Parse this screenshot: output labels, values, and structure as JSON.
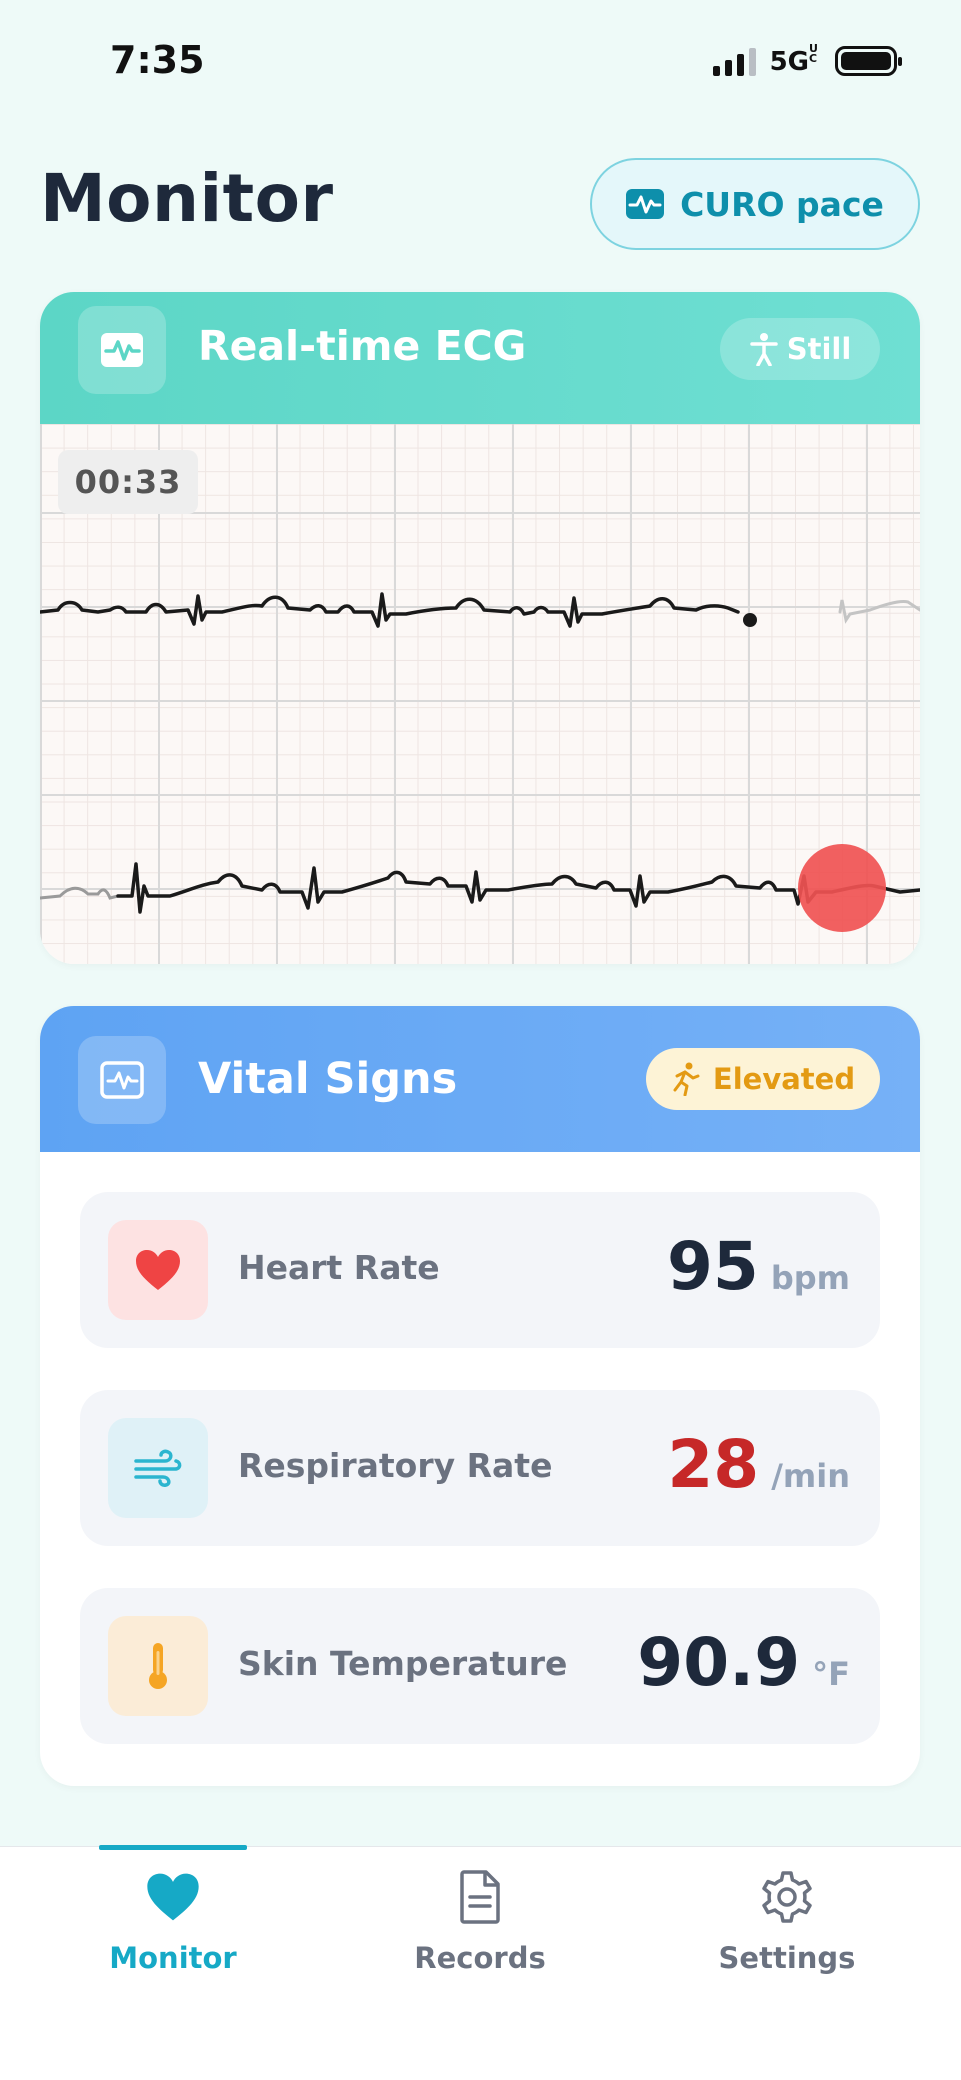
{
  "status_bar": {
    "time": "7:35",
    "network": "5G",
    "network_superscript": "UC",
    "battery_level": 1.0
  },
  "header": {
    "title": "Monitor",
    "device_button_label": "CURO pace",
    "device_button_icon": "waveform-icon"
  },
  "ecg_card": {
    "title": "Real-time ECG",
    "activity_label": "Still",
    "activity_icon": "standing-person-icon",
    "timer": "00:33",
    "accent_color": "#5cd6c6"
  },
  "vitals_card": {
    "title": "Vital Signs",
    "status_label": "Elevated",
    "status_icon": "running-person-icon",
    "accent_color": "#5ea3f3",
    "items": [
      {
        "label": "Heart Rate",
        "value": "95",
        "unit": "bpm",
        "icon": "heart-icon",
        "alert": false
      },
      {
        "label": "Respiratory Rate",
        "value": "28",
        "unit": "/min",
        "icon": "wind-icon",
        "alert": true
      },
      {
        "label": "Skin Temperature",
        "value": "90.9",
        "unit": "°F",
        "icon": "thermometer-icon",
        "alert": false
      }
    ]
  },
  "bottom_nav": {
    "items": [
      {
        "label": "Monitor",
        "icon": "heart-icon",
        "active": true
      },
      {
        "label": "Records",
        "icon": "document-icon",
        "active": false
      },
      {
        "label": "Settings",
        "icon": "gear-icon",
        "active": false
      }
    ],
    "active_color": "#16a9c6"
  }
}
